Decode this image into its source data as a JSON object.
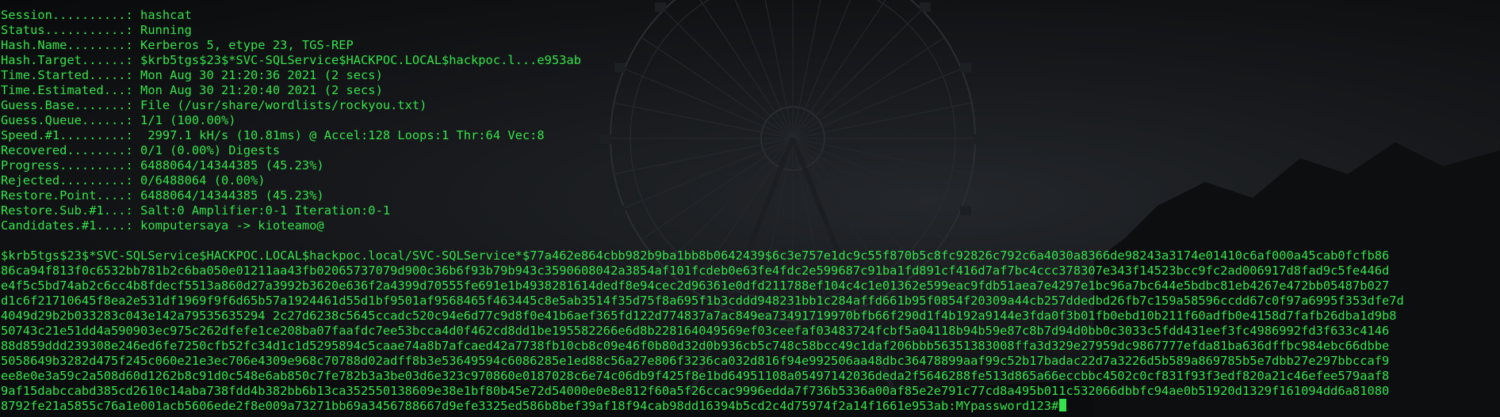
{
  "status_lines": [
    "Session..........: hashcat",
    "Status...........: Running",
    "Hash.Name........: Kerberos 5, etype 23, TGS-REP",
    "Hash.Target......: $krb5tgs$23$*SVC-SQLService$HACKPOC.LOCAL$hackpoc.l...e953ab",
    "Time.Started.....: Mon Aug 30 21:20:36 2021 (2 secs)",
    "Time.Estimated...: Mon Aug 30 21:20:40 2021 (2 secs)",
    "Guess.Base.......: File (/usr/share/wordlists/rockyou.txt)",
    "Guess.Queue......: 1/1 (100.00%)",
    "Speed.#1.........:  2997.1 kH/s (10.81ms) @ Accel:128 Loops:1 Thr:64 Vec:8",
    "Recovered........: 0/1 (0.00%) Digests",
    "Progress.........: 6488064/14344385 (45.23%)",
    "Rejected.........: 0/6488064 (0.00%)",
    "Restore.Point....: 6488064/14344385 (45.23%)",
    "Restore.Sub.#1...: Salt:0 Amplifier:0-1 Iteration:0-1",
    "Candidates.#1....: komputersaya -> kioteamo@"
  ],
  "hash_lines": [
    "$krb5tgs$23$*SVC-SQLService$HACKPOC.LOCAL$hackpoc.local/SVC-SQLService*$77a462e864cbb982b9ba1bb8b0642439$6c3e757e1dc9c55f870b5c8fc92826c792c6a4030a8366de98243a3174e01410c6af000a45cab0fcfb86",
    "86ca94f813f0c6532bb781b2c6ba050e01211aa43fb02065737079d900c36b6f93b79b943c3590608042a3854af101fcdeb0e63fe4fdc2e599687c91ba1fd891cf416d7af7bc4ccc378307e343f14523bcc9fc2ad006917d8fad9c5fe446d",
    "e4f5c5bd74ab2c6cc4b8fdecf5513a860d27a3992b3620e636f2a4399d70555fe691e1b4938281614dedf8e94cec2d96361e0dfd211788ef104c4c1e01362e599eac9fdb51aea7e4297e1bc96a7bc644e5bdbc81eb4267e472bb05487b027",
    "d1c6f21710645f8ea2e531df1969f9f6d65b57a1924461d55d1bf9501af9568465f463445c8e5ab3514f35d75f8a695f1b3cddd948231bb1c284affd661b95f0854f20309a44cb257ddedbd26fb7c159a58596ccdd67c0f97a6995f353dfe7d",
    "4049d29b2b033283c043e142a79535635294 2c27d6238c5645ccadc520c94e6d77c9d8f0e41b6aef365fd122d774837a7ac849ea73491719970bfb66f290d1f4b192a9144e3fda0f3b01fb0ebd10b211f60adfb0e4158d7fafb26dba1d9b8",
    "50743c21e51dd4a590903ec975c262dfefe1ce208ba07faafdc7ee53bcca4d0f462cd8dd1be195582266e6d8b228164049569ef03ceefaf03483724fcbf5a04118b94b59e87c8b7d94d0bb0c3033c5fdd431eef3fc4986992fd3f633c4146",
    "88d859ddd239308e246ed6fe7250cfb52fc34d1c1d5295894c5caae74a8b7afcaed42a7738fb10cb8c09e46f0b80d32d0b936cb5c748c58bcc49c1daf206bbb56351383008ffa3d329e27959dc9867777efda81ba636dffbc984ebc66dbbe",
    "5058649b3282d475f245c060e21e3ec706e4309e968c70788d02adff8b3e53649594c6086285e1ed88c56a27e806f3236ca032d816f94e992506aa48dbc36478899aaf99c52b17badac22d7a3226d5b589a869785b5e7dbb27e297bbccaf9",
    "ee8e0e3a59c2a508d60d1262b8c91d0c548e6ab850c7fe782b3a3be03d6e323c970860e0187028c6e74c06db9f425f8e1bd64951108a05497142036deda2f5646288fe513d865a66eccbbc4502c0cf831f93f3edf820a21c46efee579aaf8",
    "9af15dabccabd385cd2610c14aba738fdd4b382bb6b13ca352550138609e38e1bf80b45e72d54000e0e8e812f60a5f26ccac9996edda7f736b5336a00af85e2e791c77cd8a495b011c532066dbbfc94ae0b51920d1329f161094dd6a81080",
    "8792fe21a5855c76a1e001acb5606ede2f8e009a73271bb69a3456788667d9efe3325ed586b8bef39af18f94cab98dd16394b5cd2c4d75974f2a14f1661e953ab:MYpassword123#"
  ]
}
